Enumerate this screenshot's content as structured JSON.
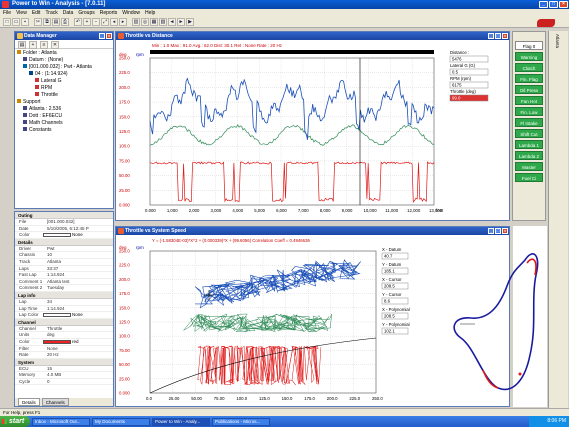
{
  "window": {
    "title": "Power to Win - Analysis - [7.0.11]"
  },
  "menu": [
    "File",
    "View",
    "Edit",
    "Track",
    "Data",
    "Groups",
    "Reports",
    "Window",
    "Help"
  ],
  "toolbar_icons": [
    "new-icon",
    "open-icon",
    "save-icon",
    "cut-icon",
    "copy-icon",
    "paste-icon",
    "print-icon",
    "undo-icon",
    "zoom-in-icon",
    "zoom-out-icon",
    "zoom-fit-icon",
    "zoom-prev-icon",
    "zoom-next-icon",
    "chart-icon",
    "map-icon",
    "table-icon",
    "report-icon",
    "back-icon",
    "forward-icon",
    "play-icon"
  ],
  "data_manager": {
    "title": "Data Manager",
    "tree": [
      "Folder : Atlanta",
      "Datum : (None)",
      "[001.000.032] : Pwt - Atlanta",
      "04 : (1:14.924)",
      "Lateral G",
      "RPM",
      "Throttle",
      "Support",
      "Atlanta : 2.536",
      "Dott : EF6ECU",
      "Math Channels",
      "Constants"
    ]
  },
  "properties": {
    "sections": [
      {
        "name": "Outing",
        "rows": [
          [
            "File",
            "[001.000.032]"
          ],
          [
            "Date",
            "5/10/2005, 6:12:45 P"
          ],
          [
            "Color",
            "None"
          ]
        ]
      },
      {
        "name": "Details",
        "rows": [
          [
            "Driver",
            "Pwt"
          ],
          [
            "Chassis",
            "10"
          ],
          [
            "Track",
            "Atlanta"
          ],
          [
            "Laps",
            "33:37"
          ],
          [
            "Fast Lap",
            "1:14.924"
          ],
          [
            "Comment 1",
            "Atlanta test"
          ],
          [
            "Comment 2",
            "Tuesday"
          ]
        ]
      },
      {
        "name": "Lap info",
        "rows": [
          [
            "Lap",
            "34"
          ],
          [
            "Lap Time",
            "1:14.924"
          ],
          [
            "Lap Color",
            "None"
          ]
        ]
      },
      {
        "name": "Channel",
        "rows": [
          [
            "Channel",
            "Throttle"
          ],
          [
            "Units",
            "deg"
          ],
          [
            "Color",
            "red"
          ],
          [
            "Filter",
            "None"
          ],
          [
            "Rate",
            "20 Hz"
          ]
        ]
      },
      {
        "name": "System",
        "rows": [
          [
            "ECU",
            "15"
          ],
          [
            "Memory",
            "4.0 MB"
          ],
          [
            "Cycle",
            "0"
          ]
        ]
      }
    ],
    "tabs": [
      "Details",
      "Channels"
    ]
  },
  "chart1": {
    "title": "Throttle vs Distance",
    "legend": "Min : 1.0  Max : 91.0  Avg.: 62.0  Dist: 30.1  Ret : None  Rate : 20 Hz",
    "unit_left": "deg",
    "unit_right": "rpm",
    "y_ticks": [
      "250.0",
      "225.0",
      "200.0",
      "175.0",
      "150.0",
      "125.0",
      "100.0",
      "75.00",
      "50.00",
      "25.00",
      "0.000"
    ],
    "x_ticks": [
      "0.000",
      "1,000",
      "2,000",
      "3,000",
      "4,000",
      "5,000",
      "6,000",
      "7,000",
      "8,000",
      "9,000",
      "10,000",
      "11,000",
      "12,000",
      "13,000"
    ],
    "x_unit": "feet",
    "readout": [
      {
        "label": "Distance :",
        "value": "5476"
      },
      {
        "label": "Lateral G (G)",
        "value": "0.5"
      },
      {
        "label": "RPM (rpm)",
        "value": "6175"
      },
      {
        "label": "Throttle (deg)",
        "value": "99.0",
        "highlight": true
      }
    ]
  },
  "chart2": {
    "title": "Throttle vs System Speed",
    "legend": "Y = (-1.58304E-03)*X^2 + (0.000339)*X + (99.6056)    Correlation Coeff = 0.4946636",
    "unit_left": "deg",
    "unit_right": "rpm",
    "y_ticks": [
      "250.0",
      "225.0",
      "200.0",
      "175.0",
      "150.0",
      "125.0",
      "100.0",
      "75.00",
      "50.00",
      "25.00",
      "0.000"
    ],
    "x_ticks": [
      "0.0",
      "25.00",
      "50.00",
      "75.00",
      "100.0",
      "125.0",
      "150.0",
      "175.0",
      "200.0",
      "225.0",
      "250.0"
    ],
    "readout": [
      {
        "label": "X - Datum",
        "value": "40.7"
      },
      {
        "label": "Y - Datum",
        "value": "185.1"
      },
      {
        "label": "X - Cursor",
        "value": "208.5"
      },
      {
        "label": "Y - Cursor",
        "value": "8.6"
      },
      {
        "label": "X - Polynomial",
        "value": "208.5"
      },
      {
        "label": "Y - Polynomial",
        "value": "102.1"
      }
    ]
  },
  "sidebar_buttons": [
    "Flag 0",
    "Warning",
    "Clutch",
    "Fin. Flag",
    "Oil Press",
    "Fan Hot",
    "Fin. Low",
    "Fl Intake",
    "Shift Cut",
    "Lambda 1",
    "Lambda 2",
    "Master",
    "Fuel Ci"
  ],
  "side_tab": "Atlanta",
  "status": "For Help, press F1",
  "taskbar": {
    "start": "start",
    "tasks": [
      "Inbox - Microsoft Out...",
      "My Documents",
      "Power to Win - Analy...",
      "Publications - Micros..."
    ],
    "clock": "8:06 PM"
  }
}
